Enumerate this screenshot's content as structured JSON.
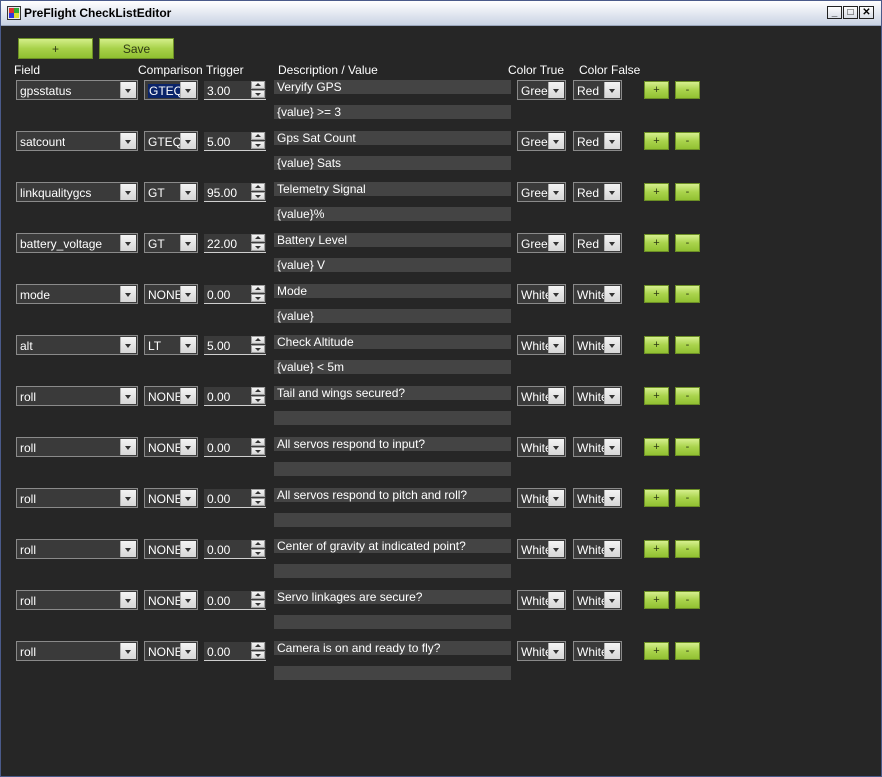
{
  "window": {
    "title": "PreFlight CheckListEditor"
  },
  "toolbar": {
    "add_label": "+",
    "save_label": "Save"
  },
  "headers": {
    "field": "Field",
    "comparison": "Comparison",
    "trigger": "Trigger",
    "description": "Description / Value",
    "color_true": "Color True",
    "color_false": "Color False"
  },
  "row_buttons": {
    "add": "+",
    "remove": "-"
  },
  "rows": [
    {
      "field": "gpsstatus",
      "comparison": "GTEQ",
      "trigger": "3.00",
      "description": "Veryify GPS",
      "value": "{value} >= 3",
      "color_true": "Green",
      "color_false": "Red"
    },
    {
      "field": "satcount",
      "comparison": "GTEQ",
      "trigger": "5.00",
      "description": "Gps Sat Count",
      "value": "{value} Sats",
      "color_true": "Green",
      "color_false": "Red"
    },
    {
      "field": "linkqualitygcs",
      "comparison": "GT",
      "trigger": "95.00",
      "description": "Telemetry Signal",
      "value": "{value}%",
      "color_true": "Green",
      "color_false": "Red"
    },
    {
      "field": "battery_voltage",
      "comparison": "GT",
      "trigger": "22.00",
      "description": "Battery Level",
      "value": "{value} V",
      "color_true": "Green",
      "color_false": "Red"
    },
    {
      "field": "mode",
      "comparison": "NONE",
      "trigger": "0.00",
      "description": "Mode",
      "value": "{value}",
      "color_true": "White",
      "color_false": "White"
    },
    {
      "field": "alt",
      "comparison": "LT",
      "trigger": "5.00",
      "description": "Check Altitude",
      "value": "{value} < 5m",
      "color_true": "White",
      "color_false": "White"
    },
    {
      "field": "roll",
      "comparison": "NONE",
      "trigger": "0.00",
      "description": "Tail and wings secured?",
      "value": "",
      "color_true": "White",
      "color_false": "White"
    },
    {
      "field": "roll",
      "comparison": "NONE",
      "trigger": "0.00",
      "description": "All servos respond to input?",
      "value": "",
      "color_true": "White",
      "color_false": "White"
    },
    {
      "field": "roll",
      "comparison": "NONE",
      "trigger": "0.00",
      "description": "All servos respond to pitch and roll?",
      "value": "",
      "color_true": "White",
      "color_false": "White"
    },
    {
      "field": "roll",
      "comparison": "NONE",
      "trigger": "0.00",
      "description": "Center of gravity at indicated point?",
      "value": "",
      "color_true": "White",
      "color_false": "White"
    },
    {
      "field": "roll",
      "comparison": "NONE",
      "trigger": "0.00",
      "description": "Servo linkages are secure?",
      "value": "",
      "color_true": "White",
      "color_false": "White"
    },
    {
      "field": "roll",
      "comparison": "NONE",
      "trigger": "0.00",
      "description": "Camera is on and ready to fly?",
      "value": "",
      "color_true": "White",
      "color_false": "White"
    }
  ],
  "colors": {
    "background": "#262626",
    "accent": "#a8d24a",
    "selection": "#0a246a"
  }
}
